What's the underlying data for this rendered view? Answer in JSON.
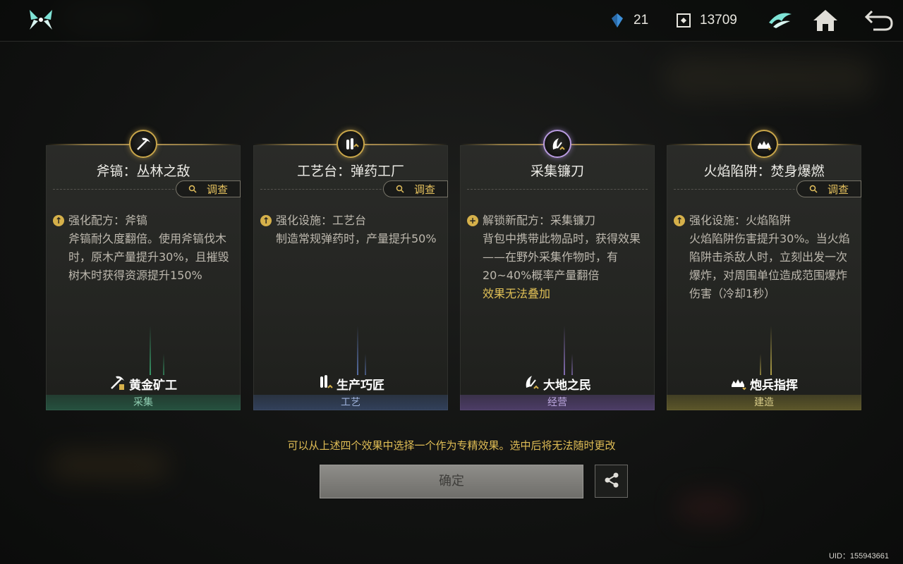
{
  "topbar": {
    "resource1_value": "21",
    "resource2_value": "13709",
    "icons": [
      "game-logo-icon",
      "crystal-icon",
      "currency-icon",
      "guild-emblem-icon",
      "home-icon",
      "back-icon"
    ]
  },
  "cards": [
    {
      "title": "斧镐：丛林之敌",
      "investigate": "调查",
      "head": "强化配方：斧镐",
      "body": "斧镐耐久度翻倍。使用斧镐伐木时，原木产量提升30%，且摧毁树木时获得资源提升150%",
      "note": "",
      "badge": "黄金矿工",
      "category": "采集",
      "icon": "pickaxe-icon",
      "accent": "#2f8f6a"
    },
    {
      "title": "工艺台：弹药工厂",
      "investigate": "调查",
      "head": "强化设施：工艺台",
      "body": "制造常规弹药时，产量提升50%",
      "note": "",
      "badge": "生产巧匠",
      "category": "工艺",
      "icon": "ammo-icon",
      "accent": "#4a6aa8"
    },
    {
      "title": "采集镰刀",
      "investigate": "",
      "head": "解锁新配方：采集镰刀",
      "body": "背包中携带此物品时，获得效果——在野外采集作物时，有20~40%概率产量翻倍",
      "note": "效果无法叠加",
      "badge": "大地之民",
      "category": "经营",
      "icon": "sickle-icon",
      "accent": "#7a5ab0"
    },
    {
      "title": "火焰陷阱：焚身爆燃",
      "investigate": "调查",
      "head": "强化设施：火焰陷阱",
      "body": "火焰陷阱伤害提升30%。当火焰陷阱击杀敌人时，立刻出发一次爆炸，对周围单位造成范围爆炸伤害（冷却1秒）",
      "note": "",
      "badge": "炮兵指挥",
      "category": "建造",
      "icon": "fire-trap-icon",
      "accent": "#a89a3a"
    }
  ],
  "hint": "可以从上述四个效果中选择一个作为专精效果。选中后将无法随时更改",
  "confirm_label": "确定",
  "uid": "UID：155943661",
  "colors": {
    "gold": "#e0bd55",
    "background": "#121312"
  }
}
